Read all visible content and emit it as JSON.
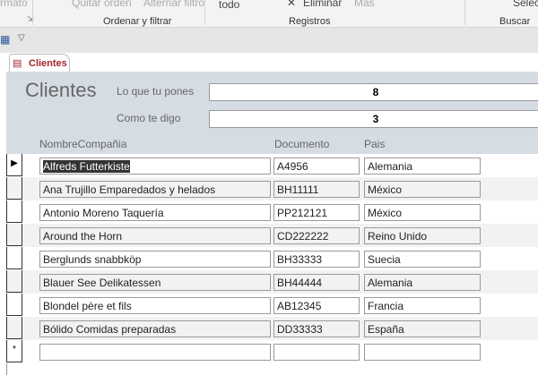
{
  "ribbon": {
    "formato": "rmato",
    "quitar_orden": "Quitar orden",
    "alternar_filtro": "Alternar filtro",
    "todo": "todo",
    "eliminar": "Eliminar",
    "mas": "Más",
    "seleccionar": "Selec",
    "groups": [
      "Ordenar y filtrar",
      "Registros",
      "Buscar"
    ]
  },
  "tab": {
    "label": "Clientes"
  },
  "form": {
    "title": "Clientes",
    "field1_label": "Lo que tu pones",
    "field1_value": "8",
    "field2_label": "Como te digo",
    "field2_value": "3"
  },
  "columns": [
    "NombreCompañia",
    "Documento",
    "Pais"
  ],
  "rows": [
    [
      "Alfreds Futterkiste",
      "A4956",
      "Alemania"
    ],
    [
      "Ana Trujillo Emparedados y helados",
      "BH11111",
      "México"
    ],
    [
      "Antonio Moreno Taquería",
      "PP212121",
      "México"
    ],
    [
      "Around the Horn",
      "CD222222",
      "Reino Unido"
    ],
    [
      "Berglunds snabbköp",
      "BH33333",
      "Suecia"
    ],
    [
      "Blauer See Delikatessen",
      "BH44444",
      "Alemania"
    ],
    [
      "Blondel père et fils",
      "AB12345",
      "Francia"
    ],
    [
      "Bólido Comidas preparadas",
      "DD33333",
      "España"
    ]
  ],
  "new_record_marker": "*"
}
